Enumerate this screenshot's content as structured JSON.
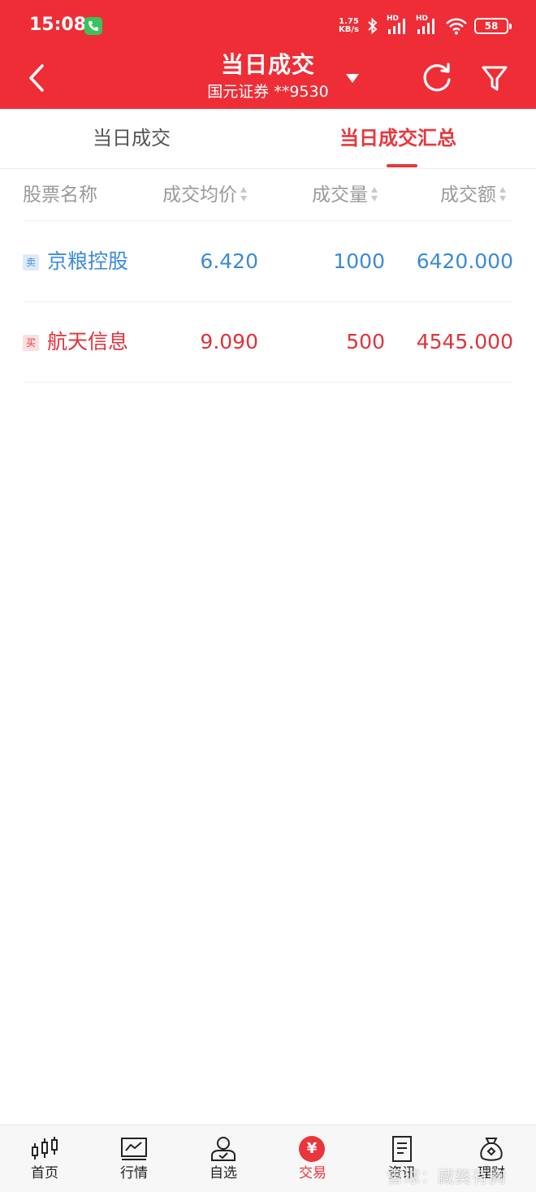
{
  "status_bar": {
    "time": "15:08",
    "net_speed_top": "1.75",
    "net_speed_bottom": "KB/s",
    "signal_1": "HD",
    "signal_2": "HD",
    "battery": "58"
  },
  "nav": {
    "title": "当日成交",
    "subtitle": "国元证券 **9530"
  },
  "tabs": [
    {
      "label": "当日成交",
      "active": false
    },
    {
      "label": "当日成交汇总",
      "active": true
    }
  ],
  "table": {
    "columns": [
      "股票名称",
      "成交均价",
      "成交量",
      "成交额"
    ],
    "rows": [
      {
        "side": "卖",
        "name": "京粮控股",
        "avg_price": "6.420",
        "volume": "1000",
        "amount": "6420.000",
        "color": "#3d8ad8"
      },
      {
        "side": "买",
        "name": "航天信息",
        "avg_price": "9.090",
        "volume": "500",
        "amount": "4545.000",
        "color": "#e0323a"
      }
    ]
  },
  "bottom_nav": [
    {
      "label": "首页",
      "icon": "candlestick-icon"
    },
    {
      "label": "行情",
      "icon": "chart-icon"
    },
    {
      "label": "自选",
      "icon": "user-check-icon"
    },
    {
      "label": "交易",
      "icon": "yuan-icon",
      "symbol": "¥",
      "active": true
    },
    {
      "label": "资讯",
      "icon": "document-icon"
    },
    {
      "label": "理财",
      "icon": "money-bag-icon"
    }
  ],
  "watermark": "雪球：藏獒有胸",
  "colors": {
    "header": "#ee2d36",
    "accent": "#e8363c",
    "sell": "#3d8ad8",
    "buy": "#e0323a"
  }
}
